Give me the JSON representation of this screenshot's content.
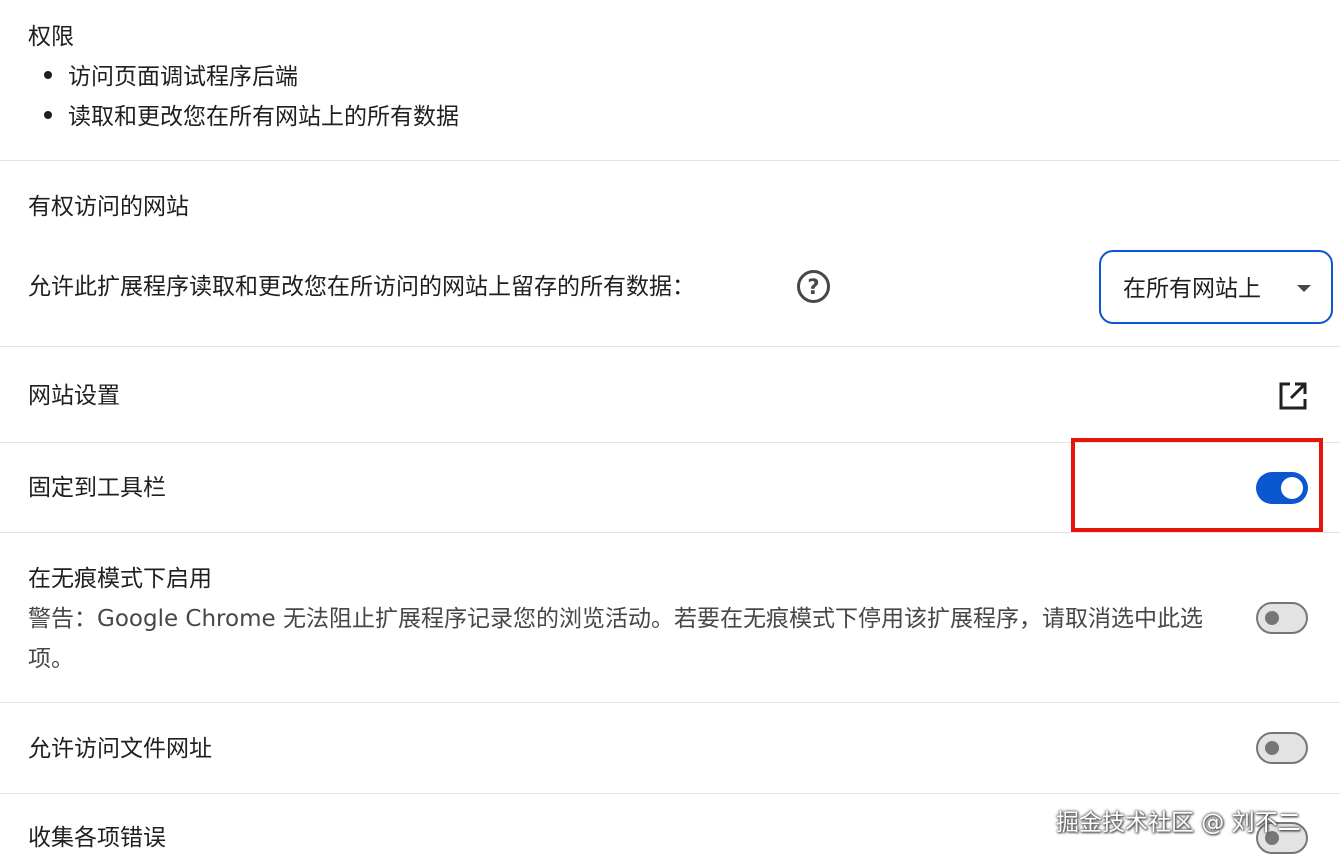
{
  "permissions": {
    "title": "权限",
    "items": [
      "访问页面调试程序后端",
      "读取和更改您在所有网站上的所有数据"
    ]
  },
  "site_access": {
    "title": "有权访问的网站",
    "description": "允许此扩展程序读取和更改您在所访问的网站上留存的所有数据：",
    "help_icon": "help-circle-icon",
    "dropdown_value": "在所有网站上"
  },
  "site_settings": {
    "label": "网站设置",
    "icon": "open-in-new-icon"
  },
  "pin_toolbar": {
    "label": "固定到工具栏",
    "enabled": true
  },
  "incognito": {
    "label": "在无痕模式下启用",
    "warning": "警告：Google Chrome 无法阻止扩展程序记录您的浏览活动。若要在无痕模式下停用该扩展程序，请取消选中此选项。",
    "enabled": false
  },
  "file_urls": {
    "label": "允许访问文件网址",
    "enabled": false
  },
  "collect_errors": {
    "label": "收集各项错误",
    "enabled": false
  },
  "watermark": "掘金技术社区 @ 刘不二",
  "colors": {
    "accent": "#0b57d0",
    "highlight": "#e8140c",
    "divider": "#e3e3e3"
  }
}
